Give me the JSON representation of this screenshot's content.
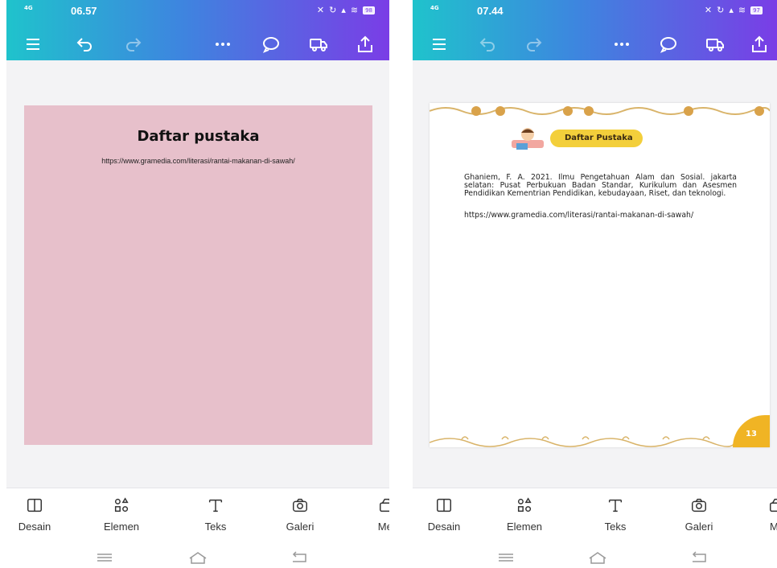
{
  "left_screen": {
    "status": {
      "network": "4G",
      "time": "06.57",
      "battery": "98"
    },
    "page": {
      "title": "Daftar pustaka",
      "url": "https://www.gramedia.com/literasi/rantai-makanan-di-sawah/"
    }
  },
  "right_screen": {
    "status": {
      "network": "4G",
      "time": "07.44",
      "battery": "97"
    },
    "page": {
      "badge": "Daftar Pustaka",
      "reference_1": "Ghaniem, F. A. 2021. Ilmu Pengetahuan Alam dan Sosial. jakarta selatan: Pusat Perbukuan Badan Standar, Kurikulum dan Asesmen Pendidikan Kementrian Pendidikan, kebudayaan, Riset, dan teknologi.",
      "reference_2": "https://www.gramedia.com/literasi/rantai-makanan-di-sawah/",
      "page_number": "13"
    }
  },
  "bottom_nav": {
    "items": [
      {
        "label": "Desain",
        "icon": "layout-icon"
      },
      {
        "label": "Elemen",
        "icon": "shapes-icon"
      },
      {
        "label": "Teks",
        "icon": "text-icon"
      },
      {
        "label": "Galeri",
        "icon": "camera-icon"
      },
      {
        "label": "Mer",
        "icon": "media-icon"
      }
    ],
    "items_right": [
      {
        "label": "Desain"
      },
      {
        "label": "Elemen"
      },
      {
        "label": "Teks"
      },
      {
        "label": "Galeri"
      },
      {
        "label": "Me"
      }
    ]
  },
  "toolbar_icons": [
    "menu-icon",
    "undo-icon",
    "redo-icon",
    "more-icon",
    "comment-icon",
    "preview-icon",
    "share-icon"
  ],
  "colors": {
    "gradient_start": "#1fc3cc",
    "gradient_end": "#7a3de6",
    "pink_page": "#e7c0cb",
    "badge_yellow": "#f3cf3b",
    "page_num_orange": "#f0b424"
  }
}
